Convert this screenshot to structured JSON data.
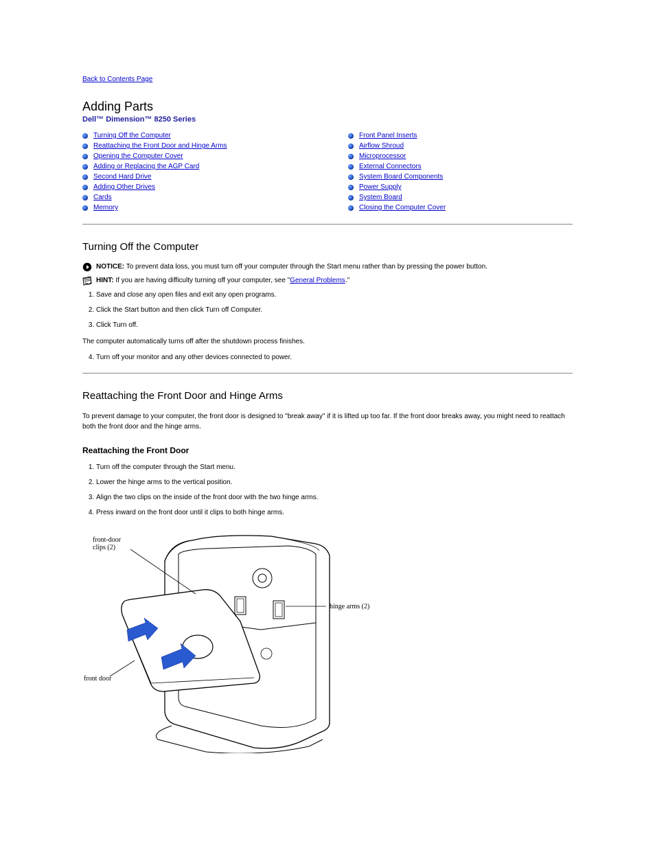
{
  "nav": {
    "back": "Back to Contents Page"
  },
  "header": {
    "title": "Adding Parts",
    "subtitle": "Dell™ Dimension™ 8250 Series"
  },
  "toc": {
    "left": [
      {
        "id": "turning-off",
        "label": "Turning Off the Computer"
      },
      {
        "id": "door-hinge",
        "label": "Reattaching the Front Door and Hinge Arms"
      },
      {
        "id": "opening",
        "label": "Opening the Computer Cover"
      },
      {
        "id": "agp",
        "label": "Adding or Replacing the AGP Card"
      },
      {
        "id": "second-hd",
        "label": "Second Hard Drive"
      },
      {
        "id": "add-drives",
        "label": "Adding Other Drives"
      },
      {
        "id": "cards",
        "label": "Cards"
      },
      {
        "id": "memory",
        "label": "Memory"
      }
    ],
    "right": [
      {
        "id": "front-panel",
        "label": "Front Panel Inserts"
      },
      {
        "id": "airflow",
        "label": "Airflow Shroud"
      },
      {
        "id": "microproc",
        "label": "Microprocessor"
      },
      {
        "id": "ext-conn",
        "label": "External Connectors"
      },
      {
        "id": "sysboard",
        "label": "System Board Components"
      },
      {
        "id": "power",
        "label": "Power Supply"
      },
      {
        "id": "sysboard2",
        "label": "System Board"
      },
      {
        "id": "closing",
        "label": "Closing the Computer Cover"
      }
    ]
  },
  "section_turnoff": {
    "heading": "Turning Off the Computer",
    "notice_label": "NOTICE:",
    "notice_text": " To prevent data loss, you must turn off your computer through the Start menu rather than by pressing the power button.",
    "hint_label": "HINT:",
    "hint_text": " If you are having difficulty turning off your computer, see \"",
    "hint_link": "General Problems",
    "hint_after": ".\"",
    "list": [
      "Save and close any open files and exit any open programs.",
      "Click the Start button and then click Turn off Computer.",
      "Click Turn off."
    ],
    "p1": "The computer automatically turns off after the shutdown process finishes.",
    "p2": "Turn off your monitor and any other devices connected to power."
  },
  "section_door": {
    "heading": "Reattaching the Front Door and Hinge Arms",
    "p1": "To prevent damage to your computer, the front door is designed to \"break away\" if it is lifted up too far. If the front door breaks away, you might need to reattach both the front door and the hinge arms.",
    "sub": "Reattaching the Front Door",
    "list": [
      "Turn off the computer through the Start menu.",
      "Lower the hinge arms to the vertical position.",
      "Align the two clips on the inside of the front door with the two hinge arms.",
      "Press inward on the front door until it clips to both hinge arms."
    ],
    "figure": {
      "label_clips": "front-door\nclips (2)",
      "label_arms": "hinge arms (2)",
      "label_door": "front door"
    }
  }
}
